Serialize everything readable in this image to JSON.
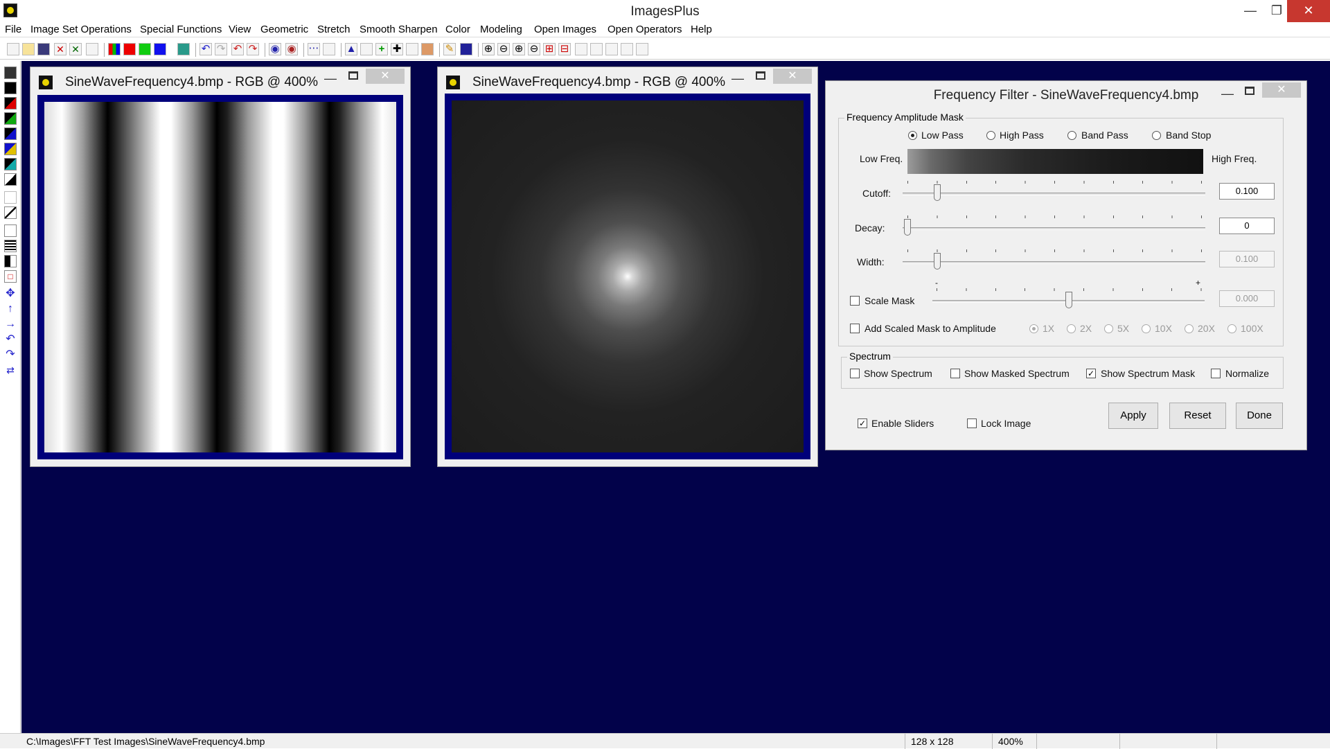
{
  "app": {
    "title": "ImagesPlus"
  },
  "menu": [
    "File",
    "Image Set Operations",
    "Special Functions",
    "View",
    "Geometric",
    "Stretch",
    "Smooth Sharpen",
    "Color",
    "Modeling",
    "Open Images",
    "Open Operators",
    "Help"
  ],
  "image_windows": [
    {
      "title": "SineWaveFrequency4.bmp - RGB @ 400%"
    },
    {
      "title": "SineWaveFrequency4.bmp - RGB @ 400%"
    }
  ],
  "dialog": {
    "title": "Frequency Filter - SineWaveFrequency4.bmp",
    "mask_group": {
      "label": "Frequency Amplitude Mask",
      "filters": [
        {
          "label": "Low Pass",
          "selected": true
        },
        {
          "label": "High Pass",
          "selected": false
        },
        {
          "label": "Band Pass",
          "selected": false
        },
        {
          "label": "Band Stop",
          "selected": false
        }
      ],
      "low_freq_label": "Low Freq.",
      "high_freq_label": "High Freq.",
      "cutoff": {
        "label": "Cutoff:",
        "value": "0.100"
      },
      "decay": {
        "label": "Decay:",
        "value": "0"
      },
      "width": {
        "label": "Width:",
        "value": "0.100"
      },
      "scale_mask": {
        "label": "Scale Mask",
        "value": "0.000",
        "minus": "-",
        "plus": "+"
      },
      "add_scaled": {
        "label": "Add Scaled Mask to Amplitude"
      },
      "multipliers": [
        "1X",
        "2X",
        "5X",
        "10X",
        "20X",
        "100X"
      ]
    },
    "spectrum_group": {
      "label": "Spectrum",
      "options": [
        {
          "label": "Show Spectrum",
          "checked": false
        },
        {
          "label": "Show Masked Spectrum",
          "checked": false
        },
        {
          "label": "Show Spectrum Mask",
          "checked": true
        },
        {
          "label": "Normalize",
          "checked": false
        }
      ]
    },
    "enable_sliders": {
      "label": "Enable Sliders",
      "checked": true
    },
    "lock_image": {
      "label": "Lock Image",
      "checked": false
    },
    "buttons": {
      "apply": "Apply",
      "reset": "Reset",
      "done": "Done"
    }
  },
  "status": {
    "path": "C:\\Images\\FFT Test Images\\SineWaveFrequency4.bmp",
    "dimensions": "128 x 128",
    "zoom": "400%"
  },
  "colors": {
    "workspace": "#02024a",
    "image_frame": "#00007a",
    "close": "#c7372f"
  }
}
